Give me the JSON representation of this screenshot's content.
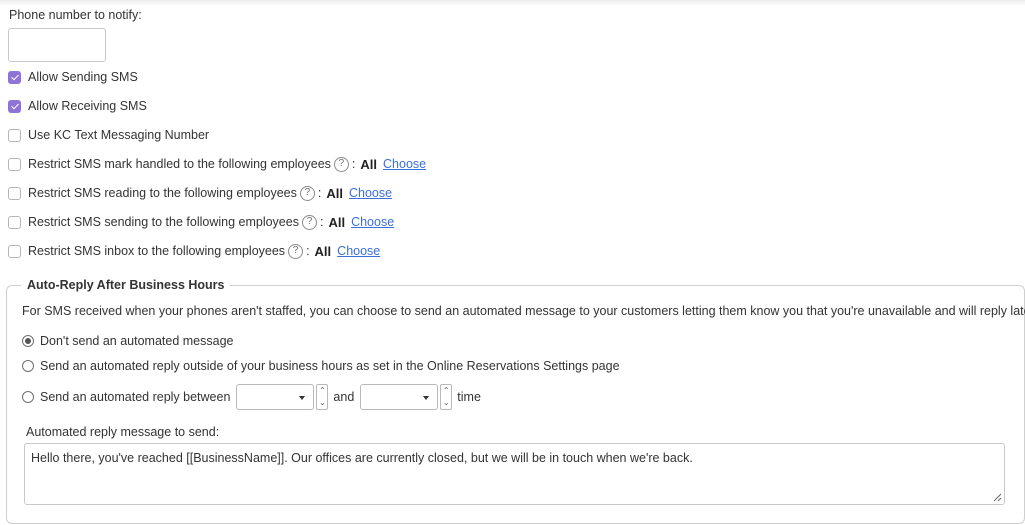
{
  "phone": {
    "label": "Phone number to notify:",
    "value": "",
    "placeholder": ""
  },
  "options": [
    {
      "label": "Allow Sending SMS",
      "checked": true
    },
    {
      "label": "Allow Receiving SMS",
      "checked": true
    },
    {
      "label": "Use KC Text Messaging Number",
      "checked": false
    }
  ],
  "restrictions": [
    {
      "label": "Restrict SMS mark handled to the following employees",
      "help": "?",
      "colon": ":",
      "value": "All",
      "link": "Choose"
    },
    {
      "label": "Restrict SMS reading to the following employees",
      "help": "?",
      "colon": ":",
      "value": "All",
      "link": "Choose"
    },
    {
      "label": "Restrict SMS sending to the following employees",
      "help": "?",
      "colon": ":",
      "value": "All",
      "link": "Choose"
    },
    {
      "label": "Restrict SMS inbox to the following employees",
      "help": "?",
      "colon": ":",
      "value": "All",
      "link": "Choose"
    }
  ],
  "autoreply": {
    "title": "Auto-Reply After Business Hours",
    "description": "For SMS received when your phones aren't staffed, you can choose to send an automated message to your customers letting them know you that you're unavailable and will reply later.",
    "radios": [
      {
        "label": "Don't send an automated message",
        "checked": true
      },
      {
        "label": "Send an automated reply outside of your business hours as set in the Online Reservations Settings page",
        "checked": false
      },
      {
        "label": "Send an automated reply between",
        "checked": false
      }
    ],
    "between": {
      "start_value": "",
      "and_label": "and",
      "end_value": "",
      "time_label": "time"
    },
    "message_label": "Automated reply message to send:",
    "message_value": "Hello there, you've reached [[BusinessName]]. Our offices are currently closed, but we will be in touch when we're back."
  },
  "colors": {
    "accent": "#8e74d6",
    "link": "#3b6fd6",
    "text": "#333333"
  }
}
